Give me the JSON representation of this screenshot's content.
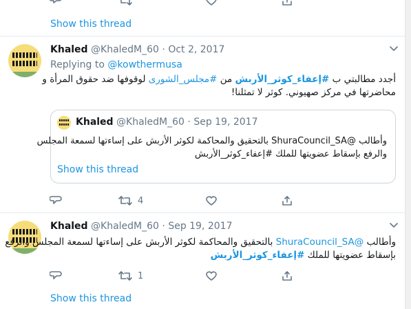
{
  "previous": {
    "show_thread": "Show this thread"
  },
  "tweet1": {
    "name": "Khaled",
    "handle": "@KhaledM_60",
    "sep": "·",
    "date": "Oct 2, 2017",
    "replying_label": "Replying to",
    "replying_to": "@kowthermusa",
    "body": {
      "l1_a": "أجدد مطالبتي ب ",
      "l1_tag1": "#إعفاء_كوثر_الأربش",
      "l1_b": " من ",
      "l1_tag2": "#مجلس_الشورى",
      "l1_c": " لوقوفها ضد حقوق المرأة و",
      "l2": "محاضرتها في مركز صهيوني. كوثر لا تمثلنا!"
    },
    "quote": {
      "name": "Khaled",
      "handle": "@KhaledM_60",
      "sep": "·",
      "date": "Sep 19, 2017",
      "l1_a": "وأطالب ",
      "l1_mention": "@ShuraCouncil_SA",
      "l1_b": " بالتحقيق والمحاكمة لكوثر الأربش على إساءتها لسمعة المجلس",
      "l2": "والرفع بإسقاط عضويتها للملك #إعفاء_كوثر_الأربش",
      "show_thread": "Show this thread"
    },
    "actions": {
      "retweets": "4"
    }
  },
  "tweet2": {
    "name": "Khaled",
    "handle": "@KhaledM_60",
    "sep": "·",
    "date": "Sep 19, 2017",
    "body": {
      "l1_a": "وأطالب ",
      "l1_mention": "@ShuraCouncil_SA",
      "l1_b": " بالتحقيق والمحاكمة لكوثر الأربش على إساءتها لسمعة المجلس والرفع",
      "l2_a": "بإسقاط عضويتها للملك ",
      "l2_tag": "#إعفاء_كوثر_الأربش"
    },
    "actions": {
      "retweets": "1"
    },
    "show_thread": "Show this thread"
  },
  "icons": {
    "reply": "reply-icon",
    "retweet": "retweet-icon",
    "like": "heart-icon",
    "share": "share-icon",
    "more": "chevron-down-icon"
  },
  "colors": {
    "link": "#1b95e0",
    "muted": "#657786",
    "border": "#e6ecf0"
  }
}
